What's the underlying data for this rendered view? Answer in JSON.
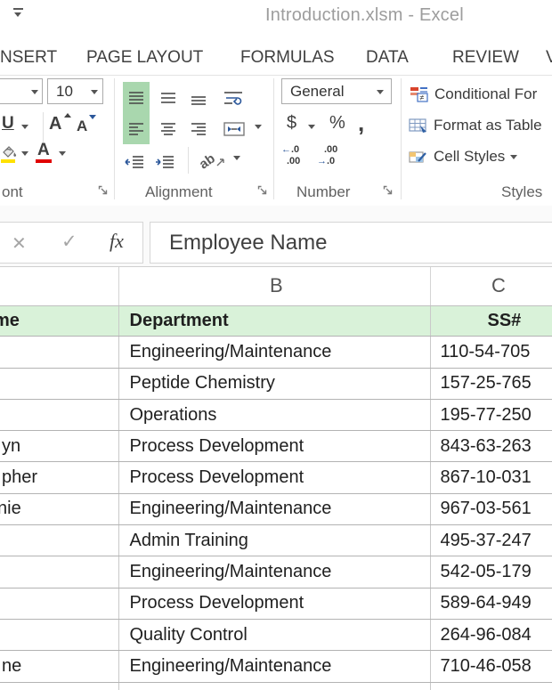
{
  "title_bar": {
    "title": "Introduction.xlsm - Excel"
  },
  "tabs": {
    "items": [
      {
        "label": "NSERT"
      },
      {
        "label": "PAGE LAYOUT"
      },
      {
        "label": "FORMULAS"
      },
      {
        "label": "DATA"
      },
      {
        "label": "REVIEW"
      },
      {
        "label": "V"
      }
    ]
  },
  "ribbon": {
    "font": {
      "group_label": "ont",
      "size_value": "10",
      "underline": "U",
      "grow_font": "A",
      "shrink_font": "A",
      "font_color_letter": "A"
    },
    "alignment": {
      "group_label": "Alignment",
      "orientation_text": "ab"
    },
    "number": {
      "group_label": "Number",
      "format_value": "General",
      "currency": "$",
      "percent": "%",
      "comma": ",",
      "increase_decimal": {
        "arrow": "←",
        "top": ".0",
        "bottom": ".00"
      },
      "decrease_decimal": {
        "top": ".00",
        "arrow": "→",
        "bottom": ".0"
      }
    },
    "styles": {
      "group_label": "Styles",
      "conditional": "Conditional For",
      "format_table": "Format as Table",
      "cell_styles": "Cell Styles",
      "not_equal": "≠"
    }
  },
  "formula_bar": {
    "cancel": "✕",
    "enter": "✓",
    "fx": "fx",
    "value": "Employee Name"
  },
  "sheet": {
    "col_b": "B",
    "col_c": "C",
    "header": {
      "a": "me",
      "b": "Department",
      "c": "SS#"
    },
    "rows": [
      {
        "a": "",
        "b": "Engineering/Maintenance",
        "c": "110-54-705"
      },
      {
        "a": "",
        "b": "Peptide Chemistry",
        "c": "157-25-765"
      },
      {
        "a": "",
        "b": "Operations",
        "c": "195-77-250"
      },
      {
        "a": "yn",
        "b": "Process Development",
        "c": "843-63-263"
      },
      {
        "a": "pher",
        "b": "Process Development",
        "c": "867-10-031"
      },
      {
        "a": "nie",
        "b": "Engineering/Maintenance",
        "c": "967-03-561"
      },
      {
        "a": "",
        "b": "Admin Training",
        "c": "495-37-247"
      },
      {
        "a": "",
        "b": "Engineering/Maintenance",
        "c": "542-05-179"
      },
      {
        "a": "",
        "b": "Process Development",
        "c": "589-64-949"
      },
      {
        "a": "",
        "b": "Quality Control",
        "c": "264-96-084"
      },
      {
        "a": "ne",
        "b": "Engineering/Maintenance",
        "c": "710-46-058"
      }
    ]
  },
  "colors": {
    "header_fill": "#d9f2d9",
    "ribbon_active_green": "#a9d7ae",
    "accent_blue": "#2b579a",
    "fill_color_bar": "#ffe100",
    "font_color_bar": "#e00000",
    "title_text": "#9d9d9d"
  }
}
